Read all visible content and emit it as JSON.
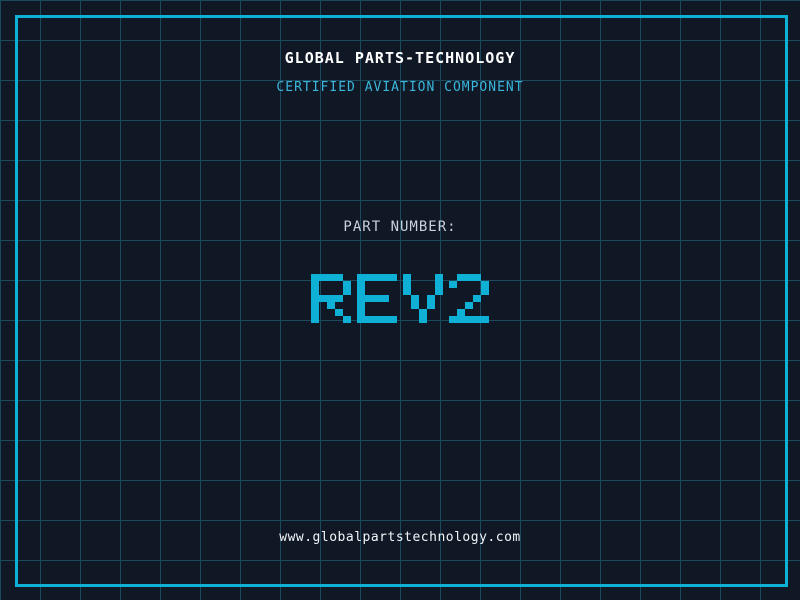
{
  "colors": {
    "background": "#101826",
    "grid-line": "#1B4A5E",
    "accent": "#0FB0D6",
    "subtitle-text": "#3AB6DC",
    "title-text": "#FFFFFF",
    "label-text": "#C9D1DC",
    "url-text": "#F2F6FA"
  },
  "header": {
    "company": "GLOBAL PARTS-TECHNOLOGY",
    "tagline": "CERTIFIED AVIATION COMPONENT"
  },
  "part": {
    "label": "PART NUMBER:",
    "number": "REV2"
  },
  "footer": {
    "website": "www.globalpartstechnology.com"
  }
}
